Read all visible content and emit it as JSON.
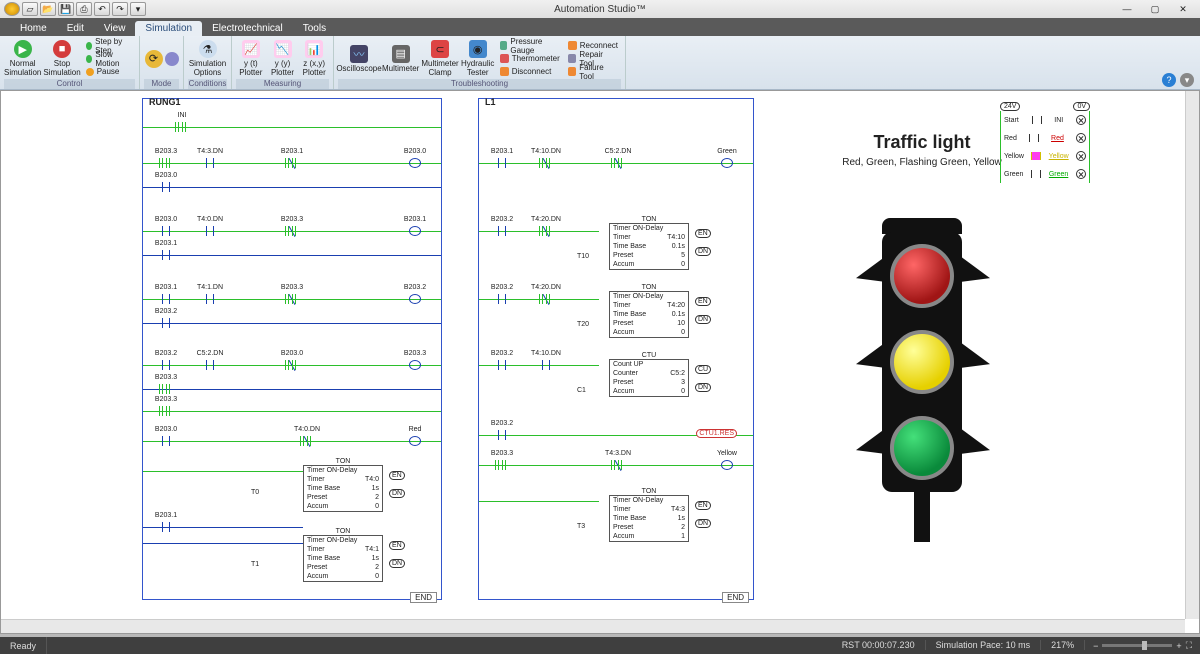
{
  "app": {
    "title": "Automation Studio™"
  },
  "qat_icons": [
    "logo",
    "new",
    "open",
    "save",
    "print",
    "undo",
    "redo",
    "dropdown"
  ],
  "menu": [
    "Home",
    "Edit",
    "View",
    "Simulation",
    "Electrotechnical",
    "Tools"
  ],
  "active_menu": "Simulation",
  "ribbon": {
    "control": {
      "label": "Control",
      "normal": "Normal Simulation",
      "stop": "Stop Simulation",
      "step": "Step by Step",
      "slow": "Slow Motion",
      "pause": "Pause"
    },
    "mode": {
      "label": "Mode"
    },
    "conditions": {
      "label": "Conditions",
      "btn": "Simulation Options"
    },
    "measuring": {
      "label": "Measuring",
      "yt": "y (t) Plotter",
      "yy": "y (y) Plotter",
      "zxy": "z (x,y) Plotter",
      "osc": "Oscilloscope",
      "mm": "Multimeter",
      "clamp": "Multimeter Clamp",
      "hyd": "Hydraulic Tester"
    },
    "troubleshooting": {
      "label": "Troubleshooting",
      "pressure": "Pressure Gauge",
      "thermo": "Thermometer",
      "disc": "Disconnect",
      "recon": "Reconnect",
      "repair": "Repair Tool",
      "fail": "Failure Tool"
    }
  },
  "canvas": {
    "rung1_title": "RUNG1",
    "l1_title": "L1",
    "end_label": "END",
    "left": {
      "ini": "INI",
      "r": [
        {
          "c": [
            "B203.3",
            "T4:3.DN",
            "B203.1",
            "B203.0"
          ]
        },
        {
          "c": [
            "B203.0"
          ]
        },
        {
          "c": [
            "B203.0",
            "T4:0.DN",
            "B203.3",
            "B203.1"
          ]
        },
        {
          "c": [
            "B203.1"
          ]
        },
        {
          "c": [
            "B203.1",
            "T4:1.DN",
            "B203.3",
            "B203.2"
          ]
        },
        {
          "c": [
            "B203.2"
          ]
        },
        {
          "c": [
            "B203.2",
            "C5:2.DN",
            "B203.0",
            "B203.3"
          ]
        },
        {
          "c": [
            "B203.3"
          ]
        },
        {
          "c": [
            "B203.0",
            "T4:0.DN",
            "Red"
          ]
        }
      ],
      "t0": {
        "id": "T0",
        "title": "TON",
        "sub": "Timer ON-Delay",
        "rows": [
          [
            "Timer",
            "T4:0"
          ],
          [
            "Time Base",
            "1s"
          ],
          [
            "Preset",
            "2"
          ],
          [
            "Accum",
            "0"
          ]
        ],
        "outs": [
          "EN",
          "DN"
        ]
      },
      "r_b2031": "B203.1",
      "t1": {
        "id": "T1",
        "title": "TON",
        "sub": "Timer ON-Delay",
        "rows": [
          [
            "Timer",
            "T4:1"
          ],
          [
            "Time Base",
            "1s"
          ],
          [
            "Preset",
            "2"
          ],
          [
            "Accum",
            "0"
          ]
        ],
        "outs": [
          "EN",
          "DN"
        ]
      }
    },
    "right": {
      "r0": [
        "B203.1",
        "T4:10.DN",
        "C5:2.DN",
        "Green"
      ],
      "r1": [
        "B203.2",
        "T4:20.DN"
      ],
      "t10": {
        "id": "T10",
        "title": "TON",
        "sub": "Timer ON-Delay",
        "rows": [
          [
            "Timer",
            "T4:10"
          ],
          [
            "Time Base",
            "0.1s"
          ],
          [
            "Preset",
            "5"
          ],
          [
            "Accum",
            "0"
          ]
        ],
        "outs": [
          "EN",
          "DN"
        ]
      },
      "r2": [
        "B203.2",
        "T4:20.DN"
      ],
      "t20": {
        "id": "T20",
        "title": "TON",
        "sub": "Timer ON-Delay",
        "rows": [
          [
            "Timer",
            "T4:20"
          ],
          [
            "Time Base",
            "0.1s"
          ],
          [
            "Preset",
            "10"
          ],
          [
            "Accum",
            "0"
          ]
        ],
        "outs": [
          "EN",
          "DN"
        ]
      },
      "r3": [
        "B203.2",
        "T4:10.DN"
      ],
      "c1": {
        "id": "C1",
        "title": "CTU",
        "sub": "Count UP",
        "rows": [
          [
            "Counter",
            "C5:2"
          ],
          [
            "Preset",
            "3"
          ],
          [
            "Accum",
            "0"
          ]
        ],
        "outs": [
          "CU",
          "DN"
        ]
      },
      "r4": [
        "B203.2",
        "CTU1.RES"
      ],
      "r5": [
        "B203.3",
        "T4:3.DN",
        "Yellow"
      ],
      "t3": {
        "id": "T3",
        "title": "TON",
        "sub": "Timer ON-Delay",
        "rows": [
          [
            "Timer",
            "T4:3"
          ],
          [
            "Time Base",
            "1s"
          ],
          [
            "Preset",
            "2"
          ],
          [
            "Accum",
            "1"
          ]
        ],
        "outs": [
          "EN",
          "DN"
        ]
      }
    }
  },
  "vis": {
    "title": "Traffic light",
    "subtitle": "Red, Green, Flashing Green, Yellow"
  },
  "mini": {
    "v24": "24V",
    "v0": "0V",
    "rows": [
      {
        "l": "Start",
        "r": "INI",
        "link": false,
        "color": ""
      },
      {
        "l": "Red",
        "r": "Red",
        "link": true,
        "color": "#c00"
      },
      {
        "l": "Yellow",
        "r": "Yellow",
        "link": true,
        "color": "#c9b400"
      },
      {
        "l": "Green",
        "r": "Green",
        "link": true,
        "color": "#0a0"
      }
    ]
  },
  "status": {
    "ready": "Ready",
    "rst": "RST 00:00:07.230",
    "pace": "Simulation Pace: 10 ms",
    "zoom": "217%"
  }
}
